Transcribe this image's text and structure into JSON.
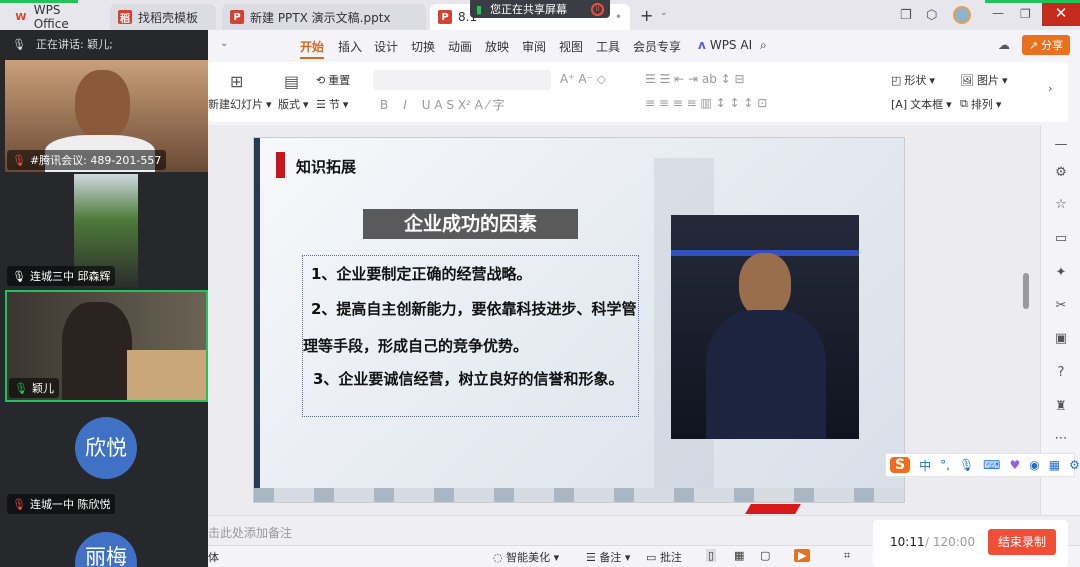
{
  "tabs": [
    {
      "label": "WPS Office",
      "icon": "W"
    },
    {
      "label": "找稻壳模板",
      "icon": "稻"
    },
    {
      "label": "新建 PPTX 演示文稿.pptx",
      "icon": "P"
    },
    {
      "label": "8.1",
      "icon": "P"
    }
  ],
  "share_banner": {
    "text": "您正在共享屏幕"
  },
  "meeting": {
    "speaking": "正在讲话: 颖儿;",
    "participants": [
      {
        "name": "#腾讯会议: 489-201-557",
        "muted": true
      },
      {
        "name": "连城三中 邱森辉",
        "muted": false
      },
      {
        "name": "颖儿",
        "muted": false,
        "active": true
      },
      {
        "name": "连城一中 陈欣悦",
        "avatar": "欣悦",
        "muted": true
      },
      {
        "avatar": "丽梅"
      }
    ]
  },
  "menu": [
    "开始",
    "插入",
    "设计",
    "切换",
    "动画",
    "放映",
    "审阅",
    "视图",
    "工具",
    "会员专享"
  ],
  "wps_ai": "WPS AI",
  "share_button": "分享",
  "ribbon": {
    "new_slide": "新建幻灯片",
    "layout": "版式",
    "reset": "重置",
    "section": "节",
    "shape": "形状",
    "picture": "图片",
    "textbox": "文本框",
    "arrange": "排列"
  },
  "slide": {
    "header": "知识拓展",
    "title": "企业成功的因素",
    "points": [
      "1、企业要制定正确的经营战略。",
      "2、提高自主创新能力，要依靠科技进步、科学管理等手段，形成自己的竞争优势。",
      "3、企业要诚信经营，树立良好的信誉和形象。"
    ]
  },
  "notes_placeholder": "击此处添加备注",
  "status": {
    "font": "体",
    "beautify": "智能美化",
    "notes": "备注",
    "comments": "批注"
  },
  "recording": {
    "elapsed": "10:11",
    "total": "/ 120:00",
    "stop": "结束录制"
  },
  "ime": {
    "mode": "中"
  },
  "colors": {
    "accent": "#e8711f",
    "record": "#f04e37",
    "active_border": "#1fc35a"
  }
}
